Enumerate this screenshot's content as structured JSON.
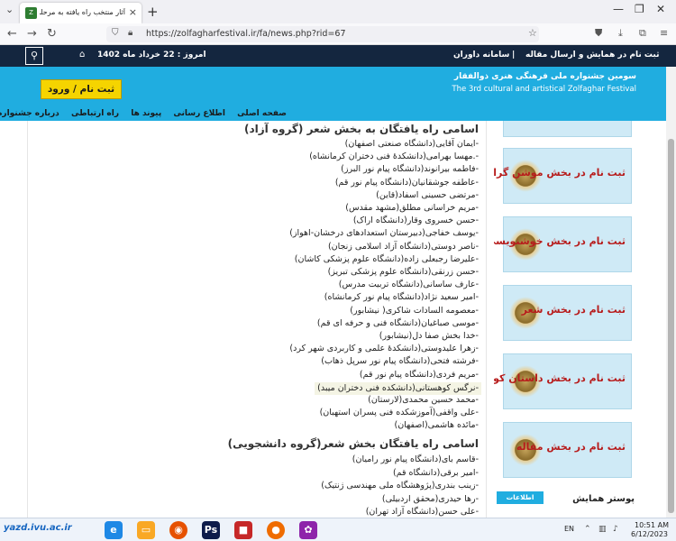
{
  "browser": {
    "tab_title": "آثار منتخب راه یافته به مرحلهٔ نهایی",
    "tab_close": "×",
    "new_tab": "+",
    "url": "https://zolfagharfestival.ir/fa/news.php?rid=67"
  },
  "topbar": {
    "link1": "ثبت نام در همایش و ارسال مقاله",
    "separator": "|",
    "link2": "سامانه داوران",
    "today": "امروز : 22 خرداد ماه 1402"
  },
  "header": {
    "register_button": "ثبت نام / ورود",
    "title_fa": "سومین جشنواره ملی فرهنگی هنری ذوالفقار",
    "title_en": "The 3rd cultural and artistical Zolfaghar Festival",
    "menu": [
      "صفحه اصلی",
      "اطلاع رسانی",
      "پیوند ها",
      "راه ارتباطی",
      "درباره جشنواره"
    ]
  },
  "content": {
    "section1_title": "اسامی راه یافتگان به بخش شعر (گروه آزاد)",
    "section1_items": [
      "-ایمان آقایی(دانشگاه صنعتی اصفهان)",
      "-.مهسا بهرامی(دانشکدهٔ فنی دختران کرمانشاه)",
      "-فاطمه بیرانوند(دانشگاه پیام نور البرز)",
      "-عاطفه جوشقانیان(دانشگاه پیام نور قم)",
      "-مرتضی حسینی اسفاد(قاین)",
      "-مریم خراسانی مطلق(مشهد مقدس)",
      "-حسن خسروی وقار(دانشگاه اراک)",
      "-یوسف خفاجی(دبیرستان استعدادهای درخشان-اهواز)",
      "-ناصر دوستی(دانشگاه آزاد اسلامی زنجان)",
      "-علیرضا رجبعلی زاده(دانشگاه علوم پزشکی کاشان)",
      "-حسن زرنقی(دانشگاه علوم پزشکی تبریز)",
      "-عارف ساسانی(دانشگاه تربیت مدرس)",
      "-امیر سعید نژاد(دانشگاه پیام نور کرمانشاه)",
      "-معصومه السادات شاکری( نیشابور)",
      "-موسی صباغیان(دانشگاه فنی و حرفه ای قم)",
      "-خدا بخش صفا دل(نیشابور)",
      "-زهرا علیدوستی(دانشکدهٔ علمی و کاربردی شهر کرد)",
      "-فرشته فتحی(دانشگاه پیام نور سرپل ذهاب)",
      "-مریم فردی(دانشگاه پیام نور قم)",
      "-نرگس کوهستانی(دانشکده فنی دختران میبد)",
      "-محمد حسین محمدی(لارستان)",
      "-علی واقفی(آموزشکده فنی پسران استهبان)",
      "-مائده هاشمی(اصفهان)"
    ],
    "section2_title": "اسامی راه یافتگان بخش شعر(گروه دانشجویی)",
    "section2_items": [
      "-قاسم بای(دانشگاه پیام نور رامیان)",
      "-امیر برقی(دانشگاه قم)",
      "-زینب بندری(پژوهشگاه ملی مهندسی ژنتیک)",
      "-رها حیدری(محقق اردبیلی)",
      "-علی حسن(دانشگاه آزاد تهران)"
    ]
  },
  "sidebar": {
    "banners": [
      "ثبت نام در بخش موشن گرافی",
      "ثبت نام در بخش خوشنویسی",
      "ثبت نام در بخش شعر",
      "ثبت نام در بخش داستان کوتاه",
      "ثبت نام در بخش مقاله"
    ],
    "poster_label": "پوستر همایش",
    "info_button": "اطلاعات بیشتر"
  },
  "taskbar": {
    "watermark": "yazd.ivu.ac.ir",
    "lang": "EN",
    "time": "10:51 AM",
    "date": "6/12/2023"
  },
  "colors": {
    "site_dark": "#14263f",
    "site_blue": "#20ade0",
    "register_yellow": "#f5d400",
    "banner_red": "#b71c1c"
  }
}
